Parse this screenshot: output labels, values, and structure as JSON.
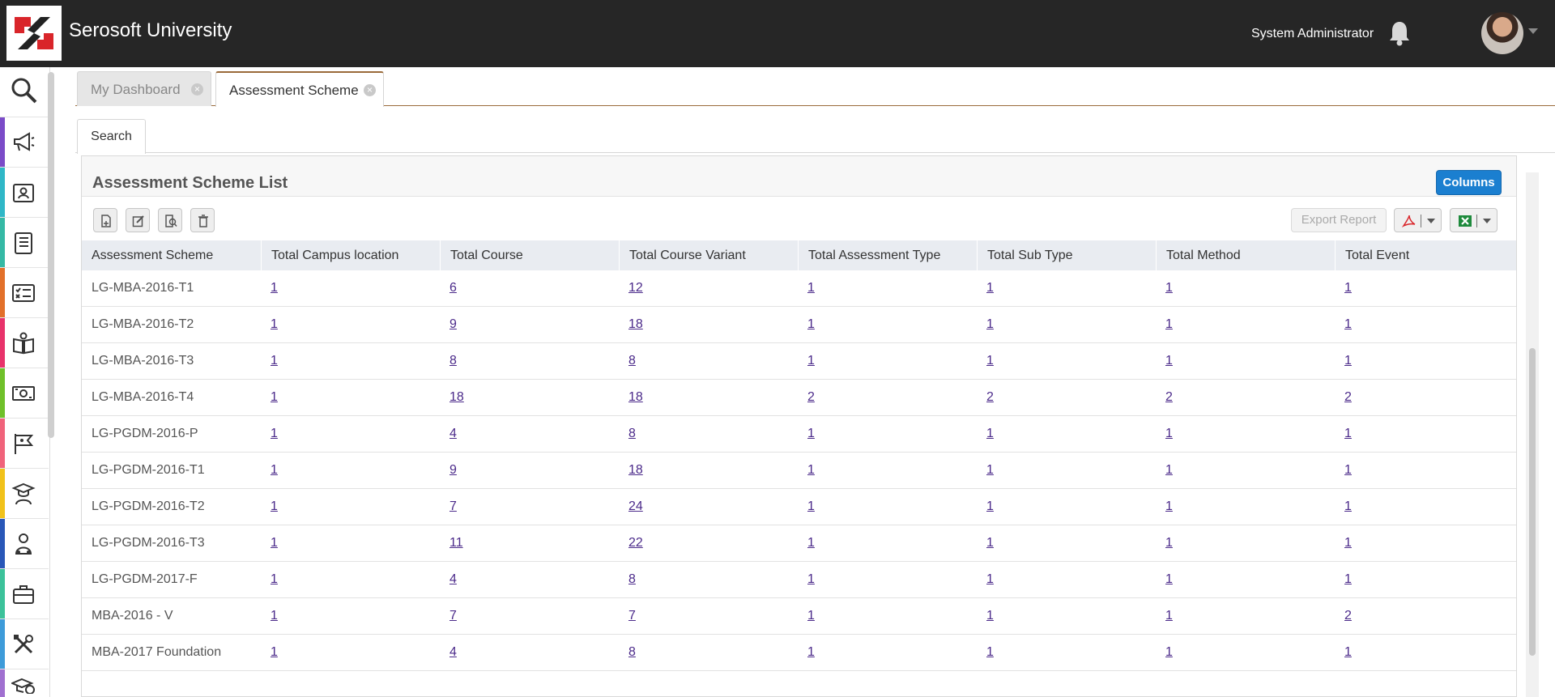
{
  "header": {
    "brand": "Serosoft University",
    "user_name": "System Administrator",
    "bell_icon": "bell-icon",
    "avatar_icon": "user-avatar"
  },
  "sidebar": {
    "items": [
      {
        "icon": "search-icon",
        "color": "#ffffff"
      },
      {
        "icon": "megaphone-icon",
        "color": "#7b4bc8"
      },
      {
        "icon": "id-card-icon",
        "color": "#2fb7c7"
      },
      {
        "icon": "book-icon",
        "color": "#35b9a5"
      },
      {
        "icon": "checklist-icon",
        "color": "#e2702a"
      },
      {
        "icon": "open-book-icon",
        "color": "#e8336b"
      },
      {
        "icon": "money-icon",
        "color": "#6fc02a"
      },
      {
        "icon": "flag-icon",
        "color": "#f0637b"
      },
      {
        "icon": "graduate-icon",
        "color": "#f1c21a"
      },
      {
        "icon": "people-icon",
        "color": "#2957b8"
      },
      {
        "icon": "briefcase-icon",
        "color": "#3cc29a"
      },
      {
        "icon": "tools-icon",
        "color": "#3e9bd9"
      },
      {
        "icon": "grad-cap-money-icon",
        "color": "#a070d0"
      }
    ]
  },
  "tabs": [
    {
      "label": "My Dashboard"
    },
    {
      "label": "Assessment Scheme"
    }
  ],
  "subtabs": [
    {
      "label": "Search"
    }
  ],
  "panel": {
    "title": "Assessment Scheme List",
    "columns_label": "Columns",
    "export_label": "Export Report"
  },
  "table": {
    "columns": [
      "Assessment Scheme",
      "Total Campus location",
      "Total Course",
      "Total Course Variant",
      "Total Assessment Type",
      "Total Sub Type",
      "Total Method",
      "Total Event"
    ],
    "rows": [
      [
        "LG-MBA-2016-T1",
        "1",
        "6",
        "12",
        "1",
        "1",
        "1",
        "1"
      ],
      [
        "LG-MBA-2016-T2",
        "1",
        "9",
        "18",
        "1",
        "1",
        "1",
        "1"
      ],
      [
        "LG-MBA-2016-T3",
        "1",
        "8",
        "8",
        "1",
        "1",
        "1",
        "1"
      ],
      [
        "LG-MBA-2016-T4",
        "1",
        "18",
        "18",
        "2",
        "2",
        "2",
        "2"
      ],
      [
        "LG-PGDM-2016-P",
        "1",
        "4",
        "8",
        "1",
        "1",
        "1",
        "1"
      ],
      [
        "LG-PGDM-2016-T1",
        "1",
        "9",
        "18",
        "1",
        "1",
        "1",
        "1"
      ],
      [
        "LG-PGDM-2016-T2",
        "1",
        "7",
        "24",
        "1",
        "1",
        "1",
        "1"
      ],
      [
        "LG-PGDM-2016-T3",
        "1",
        "11",
        "22",
        "1",
        "1",
        "1",
        "1"
      ],
      [
        "LG-PGDM-2017-F",
        "1",
        "4",
        "8",
        "1",
        "1",
        "1",
        "1"
      ],
      [
        "MBA-2016 - V",
        "1",
        "7",
        "7",
        "1",
        "1",
        "1",
        "2"
      ],
      [
        "MBA-2017 Foundation",
        "1",
        "4",
        "8",
        "1",
        "1",
        "1",
        "1"
      ]
    ]
  },
  "colors": {
    "header_bg": "#262626",
    "accent": "#1b7fd0",
    "tab_border": "#9a6a3a",
    "link": "#4b2a8a"
  }
}
